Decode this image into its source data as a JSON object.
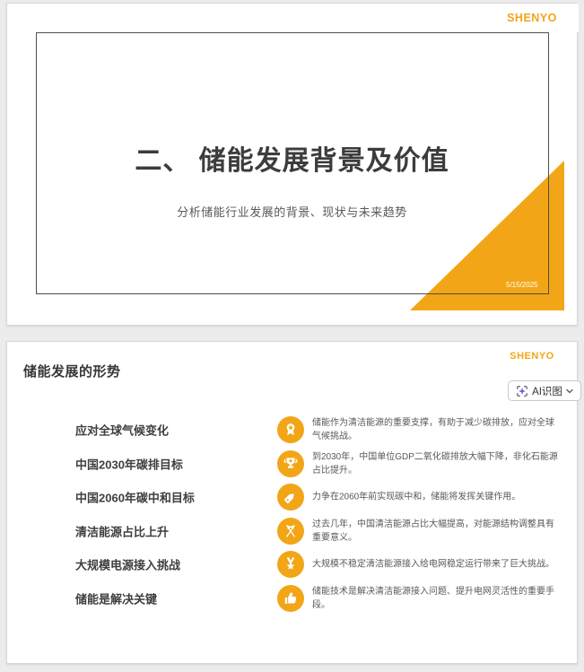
{
  "app": {
    "background_color": "#ececec",
    "accent_color": "#F2A617"
  },
  "slide1": {
    "logo": "SHENYO",
    "title": "二、 储能发展背景及价值",
    "subtitle": "分析储能行业发展的背景、现状与未来趋势",
    "date": "5/15/2025"
  },
  "slide2": {
    "logo": "SHENYO",
    "heading": "储能发展的形势",
    "ai_button": {
      "label": "AI识图",
      "icon": "ai-scan-sparkle-icon",
      "chevron": "chevron-down-icon"
    },
    "rows": [
      {
        "label": "应对全球气候变化",
        "icon": "medal-rosette-icon",
        "text": "储能作为清洁能源的重要支撑，有助于减少碳排放，应对全球\n气候挑战。"
      },
      {
        "label": "中国2030年碳排目标",
        "icon": "trophy-icon",
        "text": "到2030年，中国单位GDP二氧化碳排放大幅下降，非化石能源\n占比提升。"
      },
      {
        "label": "中国2060年碳中和目标",
        "icon": "tag-icon",
        "text": "力争在2060年前实现碳中和，储能将发挥关键作用。"
      },
      {
        "label": "清洁能源占比上升",
        "icon": "crossed-flags-icon",
        "text": "过去几年，中国清洁能源占比大幅提高，对能源结构调整具有\n重要意义。"
      },
      {
        "label": "大规模电源接入挑战",
        "icon": "medal-star-icon",
        "text": "大规模不稳定清洁能源接入给电网稳定运行带来了巨大挑战。"
      },
      {
        "label": "储能是解决关键",
        "icon": "thumbs-up-icon",
        "text": "储能技术是解决清洁能源接入问题、提升电网灵活性的重要手\n段。"
      }
    ]
  }
}
